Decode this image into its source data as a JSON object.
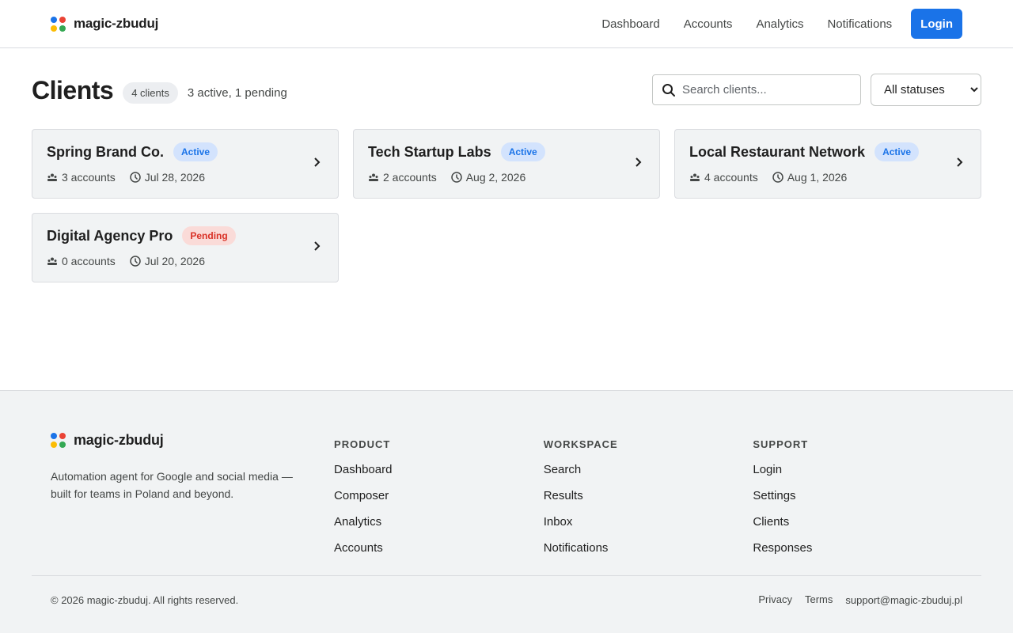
{
  "header": {
    "brand": "magic-zbuduj",
    "brand_colors": [
      "#1a73e8",
      "#ea4335",
      "#fbbc04",
      "#34a853"
    ],
    "nav": [
      "Dashboard",
      "Accounts",
      "Analytics",
      "Notifications"
    ],
    "login_label": "Login"
  },
  "main": {
    "title": "Clients",
    "count_badge": "4 clients",
    "summary": "3 active, 1 pending",
    "search": {
      "placeholder": "Search clients...",
      "value": ""
    },
    "status_filter": {
      "selected": "All statuses"
    },
    "clients": [
      {
        "name": "Spring Brand Co.",
        "status": "Active",
        "status_type": "active",
        "accounts": "3 accounts",
        "date": "Jul 28, 2026"
      },
      {
        "name": "Tech Startup Labs",
        "status": "Active",
        "status_type": "active",
        "accounts": "2 accounts",
        "date": "Aug 2, 2026"
      },
      {
        "name": "Local Restaurant Network",
        "status": "Active",
        "status_type": "active",
        "accounts": "4 accounts",
        "date": "Aug 1, 2026"
      },
      {
        "name": "Digital Agency Pro",
        "status": "Pending",
        "status_type": "pending",
        "accounts": "0 accounts",
        "date": "Jul 20, 2026"
      }
    ],
    "icons": {
      "accounts": "accounts-icon",
      "date": "clock-icon",
      "open": "chevron-right-icon"
    }
  },
  "footer": {
    "brand": "magic-zbuduj",
    "description": "Automation agent for Google and social media — built for teams in Poland and beyond.",
    "columns": [
      {
        "heading": "PRODUCT",
        "links": [
          "Dashboard",
          "Composer",
          "Analytics",
          "Accounts"
        ]
      },
      {
        "heading": "WORKSPACE",
        "links": [
          "Search",
          "Results",
          "Inbox",
          "Notifications"
        ]
      },
      {
        "heading": "SUPPORT",
        "links": [
          "Login",
          "Settings",
          "Clients",
          "Responses"
        ]
      }
    ],
    "copyright": "© 2026 magic-zbuduj. All rights reserved.",
    "bottom_links": [
      "Privacy",
      "Terms",
      "support@magic-zbuduj.pl"
    ]
  }
}
